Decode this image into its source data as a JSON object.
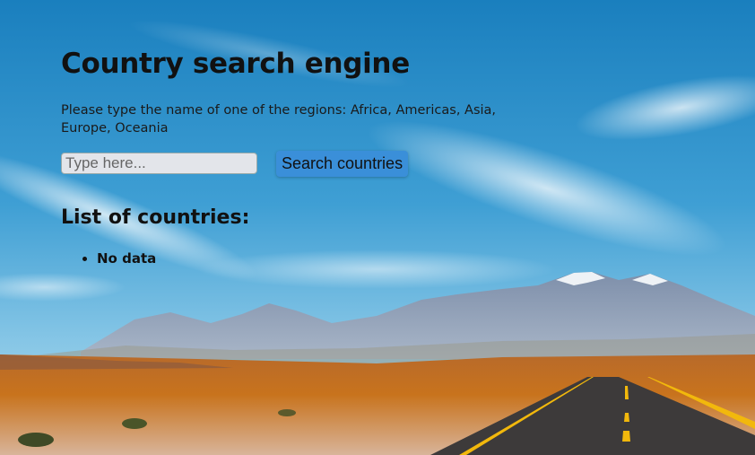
{
  "page": {
    "title": "Country search engine",
    "instructions": "Please type the name of one of the regions: Africa, Americas, Asia, Europe, Oceania",
    "search": {
      "placeholder": "Type here...",
      "value": "",
      "button_label": "Search countries"
    },
    "list": {
      "heading": "List of countries:",
      "items": [
        "No data"
      ]
    }
  },
  "colors": {
    "sky_top": "#1f86c4",
    "sky_mid": "#5fb3de",
    "button": "#3a8fd9",
    "input_bg": "#e3e5ea",
    "road": "#3d3a3a",
    "road_line": "#f2b80c",
    "desert": "#c46a1c"
  }
}
